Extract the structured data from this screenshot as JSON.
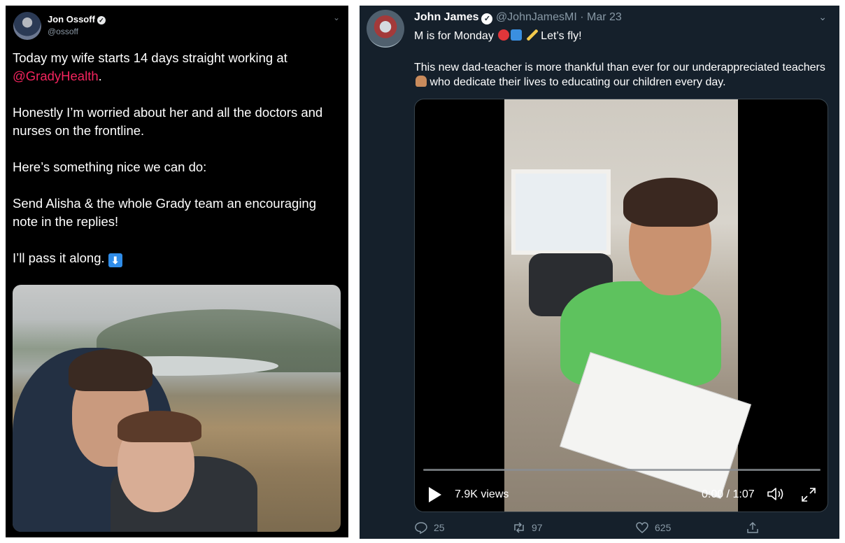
{
  "left_tweet": {
    "author_name": "Jon Ossoff",
    "verified_icon": "checkmark-badge-icon",
    "handle": "@ossoff",
    "more_icon": "chevron-down-icon",
    "line1": "Today my wife starts 14 days straight working at",
    "mention": "@GradyHealth",
    "line1_end": ".",
    "paragraph2": "Honestly I’m worried about her and all the doctors and nurses on the frontline.",
    "paragraph3": "Here’s something nice we can do:",
    "paragraph4": "Send Alisha & the whole Grady team an encouraging note in the replies!",
    "paragraph5": "I’ll pass it along.",
    "emoji_down": "⬇",
    "mention_color": "#f4245e"
  },
  "right_tweet": {
    "author_name": "John James",
    "handle": "@JohnJamesMI",
    "separator": "·",
    "date": "Mar 23",
    "line1": "M is for Monday",
    "line1_end": "Let’s fly!",
    "body_start": "This new dad-teacher is more thankful than ever for our underappreciated teachers",
    "body_end": "who dedicate their lives to educating our children every day.",
    "video": {
      "views": "7.9K views",
      "time": "0:00 / 1:07",
      "progress_fraction": 0.0
    },
    "actions": {
      "reply_count": "25",
      "retweet_count": "97",
      "like_count": "625"
    },
    "background": "#15202b"
  }
}
